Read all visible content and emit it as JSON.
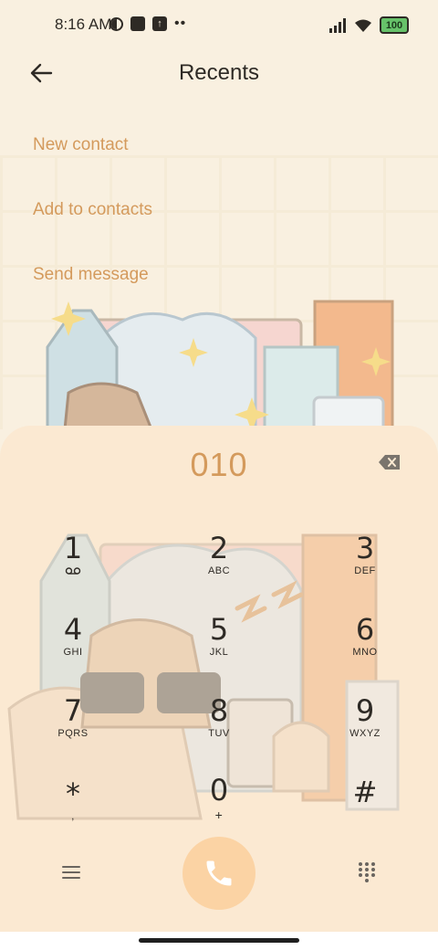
{
  "status_bar": {
    "time": "8:16 AM",
    "battery": "100",
    "icons": [
      "data-saver-icon",
      "app-notification-icon",
      "upload-icon",
      "more-dots-icon",
      "signal-icon",
      "wifi-icon",
      "battery-icon"
    ]
  },
  "header": {
    "title": "Recents"
  },
  "actions": {
    "new_contact": "New contact",
    "add_to_contacts": "Add to contacts",
    "send_message": "Send message"
  },
  "dialer": {
    "number": "010",
    "keys": [
      {
        "digit": "1",
        "letters": " "
      },
      {
        "digit": "2",
        "letters": "ABC"
      },
      {
        "digit": "3",
        "letters": "DEF"
      },
      {
        "digit": "4",
        "letters": "GHI"
      },
      {
        "digit": "5",
        "letters": "JKL"
      },
      {
        "digit": "6",
        "letters": "MNO"
      },
      {
        "digit": "7",
        "letters": "PQRS"
      },
      {
        "digit": "8",
        "letters": "TUV"
      },
      {
        "digit": "9",
        "letters": "WXYZ"
      },
      {
        "digit": "*",
        "letters": ","
      },
      {
        "digit": "0",
        "letters": "+"
      },
      {
        "digit": "#",
        "letters": ""
      }
    ]
  },
  "colors": {
    "accent": "#d49a5c",
    "background": "#f9f0e0",
    "panel": "#fbe9d2",
    "call_button": "#fbd3a4"
  }
}
